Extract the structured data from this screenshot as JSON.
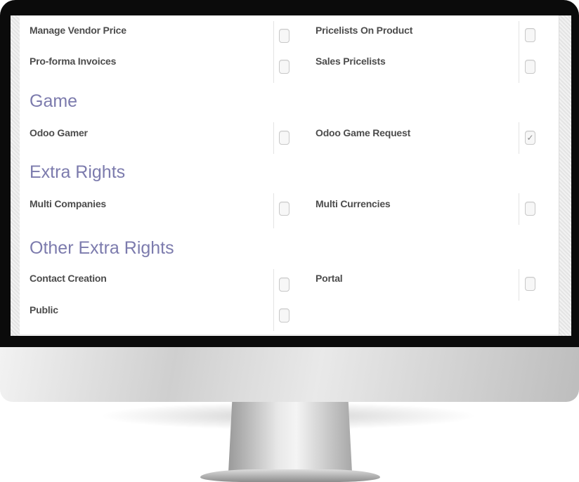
{
  "sections": [
    {
      "title": "",
      "rows": [
        [
          {
            "label": "Manage Vendor Price",
            "checked": false
          },
          {
            "label": "Pricelists On Product",
            "checked": false
          }
        ],
        [
          {
            "label": "Pro-forma Invoices",
            "checked": false
          },
          {
            "label": "Sales Pricelists",
            "checked": false
          }
        ]
      ]
    },
    {
      "title": "Game",
      "rows": [
        [
          {
            "label": "Odoo Gamer",
            "checked": false
          },
          {
            "label": "Odoo Game Request",
            "checked": true
          }
        ]
      ]
    },
    {
      "title": "Extra Rights",
      "rows": [
        [
          {
            "label": "Multi Companies",
            "checked": false
          },
          {
            "label": "Multi Currencies",
            "checked": false
          }
        ]
      ]
    },
    {
      "title": "Other Extra Rights",
      "rows": [
        [
          {
            "label": "Contact Creation",
            "checked": false
          },
          {
            "label": "Portal",
            "checked": false
          }
        ],
        [
          {
            "label": "Public",
            "checked": false
          }
        ]
      ]
    }
  ],
  "check_glyph": "✓"
}
